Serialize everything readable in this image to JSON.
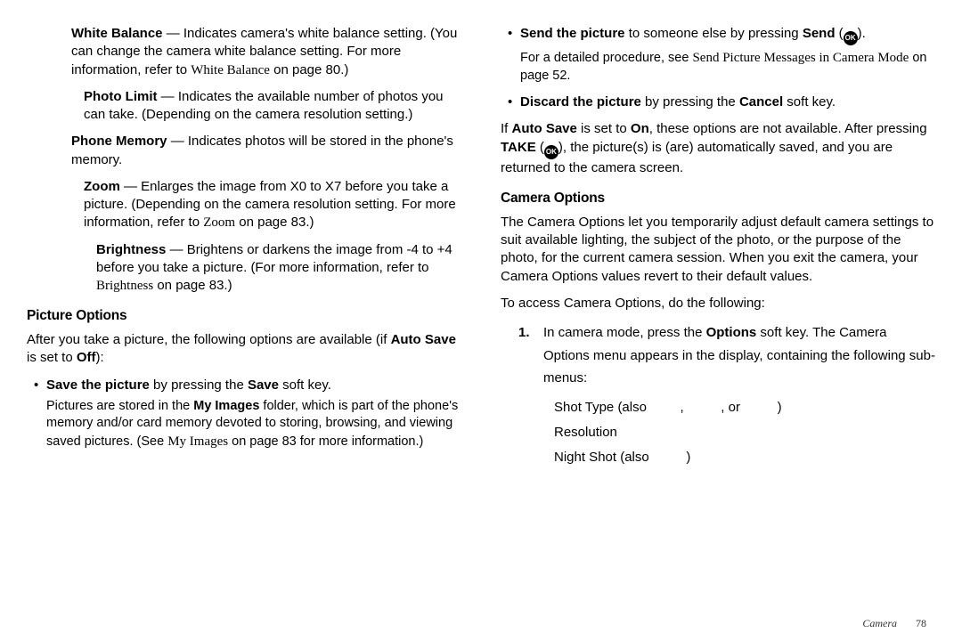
{
  "left": {
    "wb": {
      "label": "White Balance",
      "text": " — Indicates camera's white balance setting. (You can change the camera white balance setting. For more information, refer to ",
      "ref": "White Balance",
      "tail": " on page 80.)"
    },
    "photo_limit": {
      "label": "Photo Limit",
      "text": " — Indicates the available number of photos you can take. (Depending on the camera resolution setting.)"
    },
    "phone_mem": {
      "label": "Phone Memory",
      "text": " — Indicates photos will be stored in the phone's memory."
    },
    "zoom": {
      "label": "Zoom",
      "text": " — Enlarges the image from X0 to X7 before you take a picture. (Depending on the camera resolution setting. For more information, refer to ",
      "ref": "Zoom",
      "tail": " on page 83.)"
    },
    "brightness": {
      "label": "Brightness",
      "text": " — Brightens or darkens the image from -4 to +4 before you take a picture. (For more information, refer to ",
      "ref": "Brightness",
      "tail": " on page 83.)"
    },
    "picopts_heading": "Picture Options",
    "picopts_intro": {
      "a": "After you take a picture, the following options are available (if ",
      "b": "Auto Save",
      "c": " is set to ",
      "d": "Off",
      "e": "):"
    },
    "save_bullet": {
      "a": "Save the picture",
      "b": " by pressing the ",
      "c": "Save",
      "d": " soft key."
    },
    "save_detail": {
      "a": "Pictures are stored in the ",
      "b": "My Images",
      "c": " folder, which is part of the phone's memory and/or card memory devoted to storing, browsing, and viewing saved pictures. (See ",
      "d": "My Images",
      "e": " on page 83 for more information.)"
    }
  },
  "right": {
    "send_bullet": {
      "a": "Send the picture",
      "b": " to someone else by pressing ",
      "c": "Send",
      "d": " (",
      "e": ")."
    },
    "send_detail": {
      "a": "For a detailed procedure, see ",
      "b": "Send Picture Messages in Camera Mode",
      "c": " on page 52."
    },
    "discard_bullet": {
      "a": "Discard the picture",
      "b": " by pressing the ",
      "c": "Cancel",
      "d": " soft key."
    },
    "autosave_para": {
      "a": "If ",
      "b": "Auto Save",
      "c": " is set to ",
      "d": "On",
      "e": ", these options are not available. After pressing ",
      "f": "TAKE",
      "g": " (",
      "h": "), the picture(s) is (are) automatically saved, and you are returned to the camera screen."
    },
    "camopts_heading": "Camera Options",
    "camopts_intro": "The Camera Options let you temporarily adjust default camera settings to suit available lighting, the subject of the photo, or the purpose of the photo, for the current camera session. When you exit the camera, your Camera Options values revert to their default values.",
    "camopts_access": "To access Camera Options, do the following:",
    "step1": {
      "num": "1.",
      "a": "In camera mode, press the ",
      "b": "Options",
      "c": " soft key. The Camera Options menu appears in the display, containing the following sub-menus:"
    },
    "sublist": {
      "shot": "Shot Type (also         ,          , or          )",
      "res": "Resolution",
      "night": "Night Shot (also          )"
    }
  },
  "footer": {
    "section": "Camera",
    "page": "78"
  },
  "ok_glyph": "OK"
}
